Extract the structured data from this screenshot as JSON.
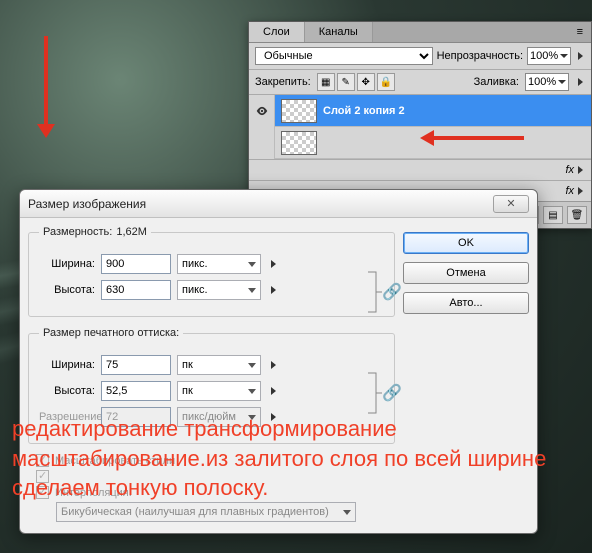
{
  "layers_panel": {
    "tab_layers": "Слои",
    "tab_channels": "Каналы",
    "blend_mode": "Обычные",
    "opacity_label": "Непрозрачность:",
    "opacity_value": "100%",
    "lock_label": "Закрепить:",
    "fill_label": "Заливка:",
    "fill_value": "100%",
    "layer_selected_name": "Слой 2 копия 2",
    "fx_label": "fx"
  },
  "dialog": {
    "title": "Размер изображения",
    "group1_legend": "Размерность:",
    "filesize": "1,62M",
    "width_label": "Ширина:",
    "height_label": "Высота:",
    "px_w": "900",
    "px_h": "630",
    "unit_px": "пикс.",
    "group2_legend": "Размер печатного оттиска:",
    "doc_w": "75",
    "doc_h": "52,5",
    "unit_pk": "пк",
    "res_label": "Разрешение:",
    "res_val": "72",
    "unit_res": "пикс/дюйм",
    "scale_styles": "Масштабировать стили",
    "interpolation_label": "Интерполяция:",
    "interp_method": "Бикубическая (наилучшая для плавных градиентов)",
    "btn_ok": "OK",
    "btn_cancel": "Отмена",
    "btn_auto": "Авто..."
  },
  "overlay": "редактирование трансформирование масштабирование.из залитого слоя по всей ширине сделаем тонкую полоску."
}
